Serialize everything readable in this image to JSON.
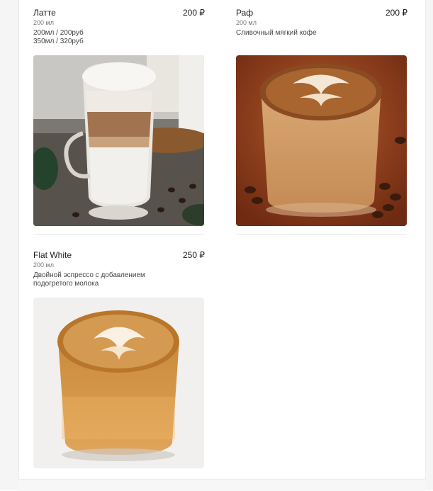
{
  "menu": {
    "items": [
      {
        "title": "Латте",
        "price": "200 ₽",
        "volume": "200 мл",
        "description": "200мл / 200руб\n350мл / 320руб",
        "image": "latte-photo"
      },
      {
        "title": "Раф",
        "price": "200 ₽",
        "volume": "200 мл",
        "description": "Сливочный мягкий кофе",
        "image": "raf-photo"
      },
      {
        "title": "Flat White",
        "price": "250 ₽",
        "volume": "200 мл",
        "description": "Двойной эспрессо с добавлением\nподогретого молока",
        "image": "flat-white-photo"
      }
    ]
  }
}
